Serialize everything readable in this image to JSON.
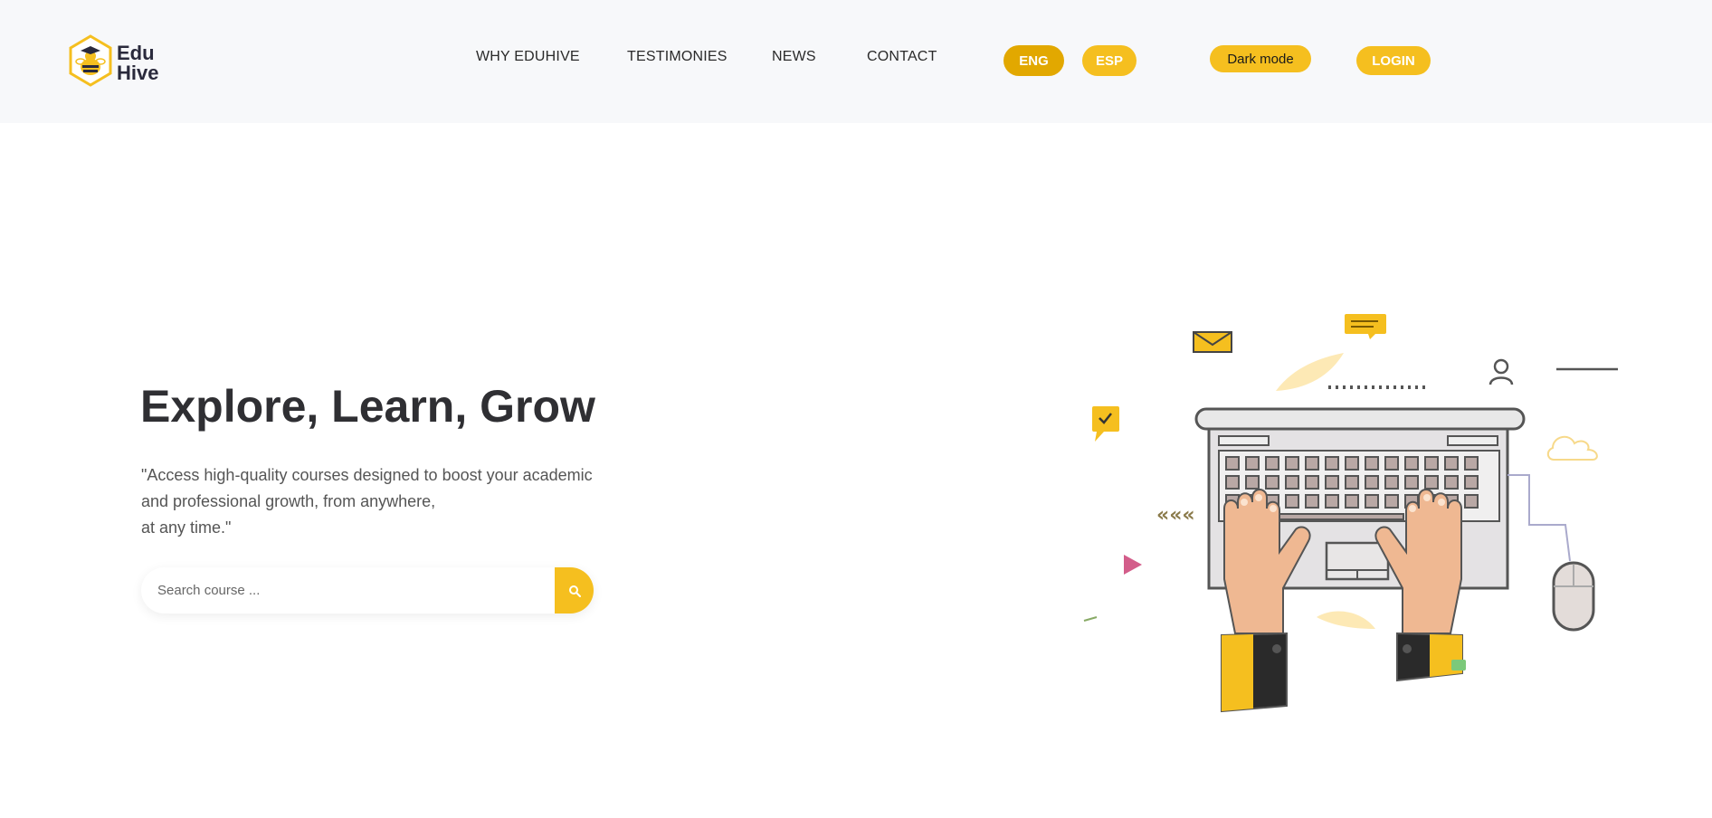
{
  "brand": {
    "line1": "Edu",
    "line2": "Hive",
    "icon": "bee-graduation-icon",
    "accent": "#f5bf1f"
  },
  "nav": {
    "items": [
      "WHY EDUHIVE",
      "TESTIMONIES",
      "NEWS",
      "CONTACT"
    ]
  },
  "language": {
    "eng": "ENG",
    "esp": "ESP",
    "selected": "ENG"
  },
  "theme": {
    "dark_mode_label": "Dark mode"
  },
  "auth": {
    "login_label": "LOGIN"
  },
  "hero": {
    "title": "Explore, Learn, Grow",
    "subtitle_lines": [
      "\"Access high-quality courses designed to boost your academic",
      "and professional growth, from anywhere,",
      "at any time.\""
    ]
  },
  "search": {
    "placeholder": "Search course ...",
    "value": "",
    "icon": "search-icon"
  },
  "illustration": {
    "icon": "laptop-typing-hands-illustration"
  }
}
